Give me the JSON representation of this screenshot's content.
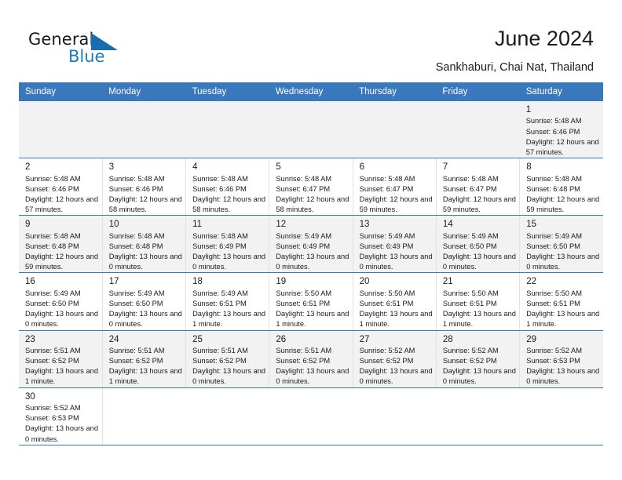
{
  "brand": {
    "name_top": "General",
    "name_bottom": "Blue",
    "mark": "triangle-flag-icon",
    "accent_color": "#1a7cc1"
  },
  "header": {
    "title": "June 2024",
    "subtitle": "Sankhaburi, Chai Nat, Thailand"
  },
  "calendar": {
    "header_bg": "#3a78bd",
    "weekday_headers": [
      "Sunday",
      "Monday",
      "Tuesday",
      "Wednesday",
      "Thursday",
      "Friday",
      "Saturday"
    ],
    "weeks": [
      [
        null,
        null,
        null,
        null,
        null,
        null,
        {
          "day": "1",
          "sunrise": "Sunrise: 5:48 AM",
          "sunset": "Sunset: 6:46 PM",
          "daylight": "Daylight: 12 hours and 57 minutes."
        }
      ],
      [
        {
          "day": "2",
          "sunrise": "Sunrise: 5:48 AM",
          "sunset": "Sunset: 6:46 PM",
          "daylight": "Daylight: 12 hours and 57 minutes."
        },
        {
          "day": "3",
          "sunrise": "Sunrise: 5:48 AM",
          "sunset": "Sunset: 6:46 PM",
          "daylight": "Daylight: 12 hours and 58 minutes."
        },
        {
          "day": "4",
          "sunrise": "Sunrise: 5:48 AM",
          "sunset": "Sunset: 6:46 PM",
          "daylight": "Daylight: 12 hours and 58 minutes."
        },
        {
          "day": "5",
          "sunrise": "Sunrise: 5:48 AM",
          "sunset": "Sunset: 6:47 PM",
          "daylight": "Daylight: 12 hours and 58 minutes."
        },
        {
          "day": "6",
          "sunrise": "Sunrise: 5:48 AM",
          "sunset": "Sunset: 6:47 PM",
          "daylight": "Daylight: 12 hours and 59 minutes."
        },
        {
          "day": "7",
          "sunrise": "Sunrise: 5:48 AM",
          "sunset": "Sunset: 6:47 PM",
          "daylight": "Daylight: 12 hours and 59 minutes."
        },
        {
          "day": "8",
          "sunrise": "Sunrise: 5:48 AM",
          "sunset": "Sunset: 6:48 PM",
          "daylight": "Daylight: 12 hours and 59 minutes."
        }
      ],
      [
        {
          "day": "9",
          "sunrise": "Sunrise: 5:48 AM",
          "sunset": "Sunset: 6:48 PM",
          "daylight": "Daylight: 12 hours and 59 minutes."
        },
        {
          "day": "10",
          "sunrise": "Sunrise: 5:48 AM",
          "sunset": "Sunset: 6:48 PM",
          "daylight": "Daylight: 13 hours and 0 minutes."
        },
        {
          "day": "11",
          "sunrise": "Sunrise: 5:48 AM",
          "sunset": "Sunset: 6:49 PM",
          "daylight": "Daylight: 13 hours and 0 minutes."
        },
        {
          "day": "12",
          "sunrise": "Sunrise: 5:49 AM",
          "sunset": "Sunset: 6:49 PM",
          "daylight": "Daylight: 13 hours and 0 minutes."
        },
        {
          "day": "13",
          "sunrise": "Sunrise: 5:49 AM",
          "sunset": "Sunset: 6:49 PM",
          "daylight": "Daylight: 13 hours and 0 minutes."
        },
        {
          "day": "14",
          "sunrise": "Sunrise: 5:49 AM",
          "sunset": "Sunset: 6:50 PM",
          "daylight": "Daylight: 13 hours and 0 minutes."
        },
        {
          "day": "15",
          "sunrise": "Sunrise: 5:49 AM",
          "sunset": "Sunset: 6:50 PM",
          "daylight": "Daylight: 13 hours and 0 minutes."
        }
      ],
      [
        {
          "day": "16",
          "sunrise": "Sunrise: 5:49 AM",
          "sunset": "Sunset: 6:50 PM",
          "daylight": "Daylight: 13 hours and 0 minutes."
        },
        {
          "day": "17",
          "sunrise": "Sunrise: 5:49 AM",
          "sunset": "Sunset: 6:50 PM",
          "daylight": "Daylight: 13 hours and 0 minutes."
        },
        {
          "day": "18",
          "sunrise": "Sunrise: 5:49 AM",
          "sunset": "Sunset: 6:51 PM",
          "daylight": "Daylight: 13 hours and 1 minute."
        },
        {
          "day": "19",
          "sunrise": "Sunrise: 5:50 AM",
          "sunset": "Sunset: 6:51 PM",
          "daylight": "Daylight: 13 hours and 1 minute."
        },
        {
          "day": "20",
          "sunrise": "Sunrise: 5:50 AM",
          "sunset": "Sunset: 6:51 PM",
          "daylight": "Daylight: 13 hours and 1 minute."
        },
        {
          "day": "21",
          "sunrise": "Sunrise: 5:50 AM",
          "sunset": "Sunset: 6:51 PM",
          "daylight": "Daylight: 13 hours and 1 minute."
        },
        {
          "day": "22",
          "sunrise": "Sunrise: 5:50 AM",
          "sunset": "Sunset: 6:51 PM",
          "daylight": "Daylight: 13 hours and 1 minute."
        }
      ],
      [
        {
          "day": "23",
          "sunrise": "Sunrise: 5:51 AM",
          "sunset": "Sunset: 6:52 PM",
          "daylight": "Daylight: 13 hours and 1 minute."
        },
        {
          "day": "24",
          "sunrise": "Sunrise: 5:51 AM",
          "sunset": "Sunset: 6:52 PM",
          "daylight": "Daylight: 13 hours and 1 minute."
        },
        {
          "day": "25",
          "sunrise": "Sunrise: 5:51 AM",
          "sunset": "Sunset: 6:52 PM",
          "daylight": "Daylight: 13 hours and 0 minutes."
        },
        {
          "day": "26",
          "sunrise": "Sunrise: 5:51 AM",
          "sunset": "Sunset: 6:52 PM",
          "daylight": "Daylight: 13 hours and 0 minutes."
        },
        {
          "day": "27",
          "sunrise": "Sunrise: 5:52 AM",
          "sunset": "Sunset: 6:52 PM",
          "daylight": "Daylight: 13 hours and 0 minutes."
        },
        {
          "day": "28",
          "sunrise": "Sunrise: 5:52 AM",
          "sunset": "Sunset: 6:52 PM",
          "daylight": "Daylight: 13 hours and 0 minutes."
        },
        {
          "day": "29",
          "sunrise": "Sunrise: 5:52 AM",
          "sunset": "Sunset: 6:53 PM",
          "daylight": "Daylight: 13 hours and 0 minutes."
        }
      ],
      [
        {
          "day": "30",
          "sunrise": "Sunrise: 5:52 AM",
          "sunset": "Sunset: 6:53 PM",
          "daylight": "Daylight: 13 hours and 0 minutes."
        },
        null,
        null,
        null,
        null,
        null,
        null
      ]
    ]
  }
}
